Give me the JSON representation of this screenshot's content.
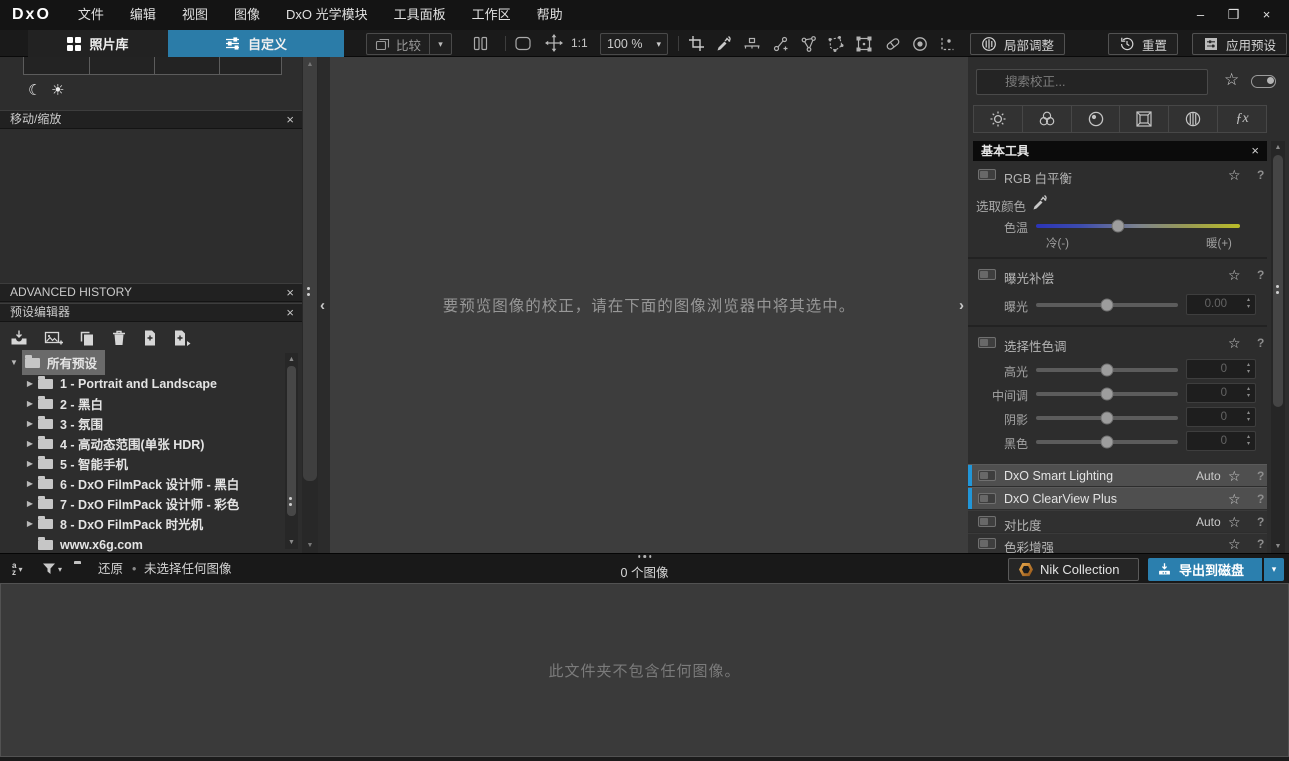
{
  "window": {
    "logo": "DxO"
  },
  "menubar": {
    "items": [
      "文件",
      "编辑",
      "视图",
      "图像",
      "DxO 光学模块",
      "工具面板",
      "工作区",
      "帮助"
    ]
  },
  "toolbar": {
    "tab_photo_library": "照片库",
    "tab_customize": "自定义",
    "compare": "比较",
    "one_to_one": "1:1",
    "zoom_level": "100 %",
    "local_adjustments": "局部调整",
    "reset": "重置",
    "apply_preset": "应用预设"
  },
  "left_panel": {
    "move_zoom_title": "移动/缩放",
    "advanced_history_title": "ADVANCED HISTORY",
    "preset_editor_title": "预设编辑器",
    "tree_root": "所有预设",
    "tree_items": [
      "1 - Portrait and Landscape",
      "2 - 黑白",
      "3 - 氛围",
      "4 - 高动态范围(单张 HDR)",
      "5 - 智能手机",
      "6 - DxO FilmPack 设计师 - 黑白",
      "7 - DxO FilmPack 设计师 - 彩色",
      "8 - DxO FilmPack 时光机",
      "www.x6g.com"
    ]
  },
  "viewer": {
    "message": "要预览图像的校正，请在下面的图像浏览器中将其选中。"
  },
  "right_panel": {
    "search_placeholder": "搜索校正...",
    "basic_tools_title": "基本工具",
    "rgb_white_balance": "RGB 白平衡",
    "pick_color": "选取颜色",
    "temperature": "色温",
    "cold": "冷(-)",
    "warm": "暖(+)",
    "exposure_comp": "曝光补偿",
    "exposure": "曝光",
    "exposure_value": "0.00",
    "selective_tone": "选择性色调",
    "tone_sliders": [
      {
        "label": "高光",
        "value": "0"
      },
      {
        "label": "中间调",
        "value": "0"
      },
      {
        "label": "阴影",
        "value": "0"
      },
      {
        "label": "黑色",
        "value": "0"
      }
    ],
    "smart_lighting": "DxO Smart Lighting",
    "clearview": "DxO ClearView Plus",
    "contrast": "对比度",
    "color_enhance": "色彩增强",
    "auto": "Auto"
  },
  "statusbar": {
    "restore": "还原",
    "no_selection": "未选择任何图像",
    "image_count": "0 个图像",
    "nik": "Nik Collection",
    "export": "导出到磁盘"
  },
  "browser": {
    "empty_message": "此文件夹不包含任何图像。"
  },
  "icons": {
    "close": "×",
    "star": "☆",
    "help": "?",
    "dropdown": "▾",
    "tree_expanded": "▼",
    "tree_collapsed": "▶",
    "spin_up": "▴",
    "spin_down": "▾",
    "moon": "☾",
    "sun": "☀",
    "collapse_left": "‹",
    "collapse_right": "›",
    "scroll_up": "▲",
    "scroll_down": "▼",
    "minimize": "–",
    "maximize": "❒",
    "window_close": "×",
    "bullet": "•",
    "fx": "ƒx",
    "az_a": "a",
    "az_z": "z"
  },
  "colors": {
    "accent_blue": "#2b7ca8",
    "selection_blue": "#2196d8",
    "nik_orange": "#d0892c",
    "panel_bg": "#2d2d2d",
    "viewer_bg": "#3d3d3d"
  }
}
